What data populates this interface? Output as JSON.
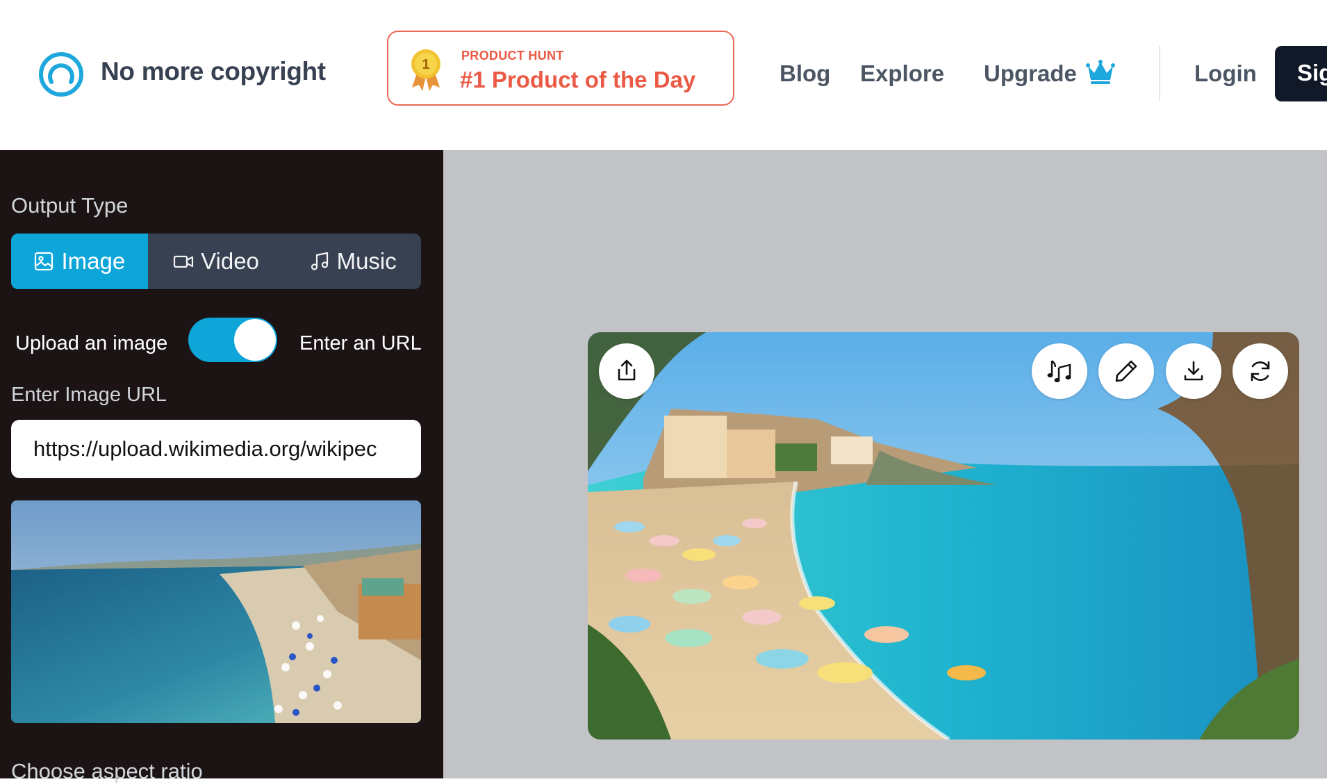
{
  "header": {
    "brand": "No more copyright",
    "producthunt": {
      "small": "PRODUCT HUNT",
      "big": "#1 Product of the Day",
      "medal_number": "1"
    },
    "nav": {
      "blog": "Blog",
      "explore": "Explore",
      "upgrade": "Upgrade",
      "login": "Login",
      "signup": "Sig"
    }
  },
  "sidebar": {
    "output_type_label": "Output Type",
    "tabs": [
      {
        "label": "Image",
        "icon": "image-icon",
        "active": true
      },
      {
        "label": "Video",
        "icon": "video-icon",
        "active": false
      },
      {
        "label": "Music",
        "icon": "music-icon",
        "active": false
      }
    ],
    "toggle": {
      "left_label": "Upload an image",
      "right_label": "Enter an URL",
      "on": true
    },
    "url_label": "Enter Image URL",
    "url_value": "https://upload.wikimedia.org/wikipec",
    "aspect_label": "Choose aspect ratio"
  },
  "main": {
    "actions": [
      "share-icon",
      "music-notes-icon",
      "pencil-icon",
      "download-icon",
      "refresh-icon"
    ]
  },
  "colors": {
    "accent": "#0ea5d9",
    "producthunt": "#ea5a45",
    "sidebar_bg": "#1c1414",
    "main_bg": "#c2c3c7",
    "nav_text": "#4b5563"
  }
}
